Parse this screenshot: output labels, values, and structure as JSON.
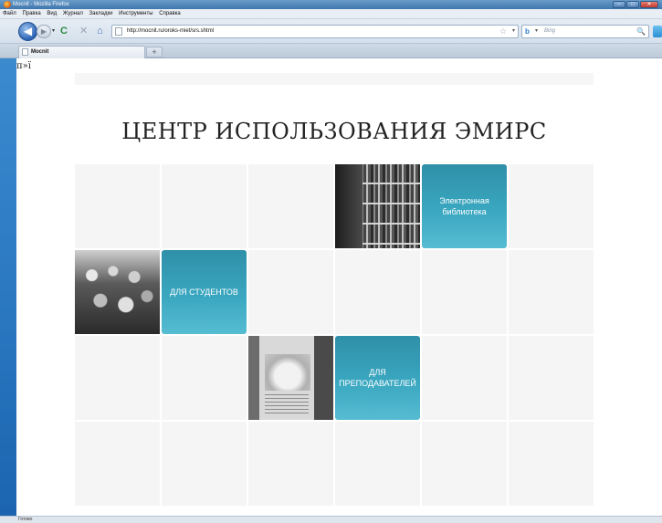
{
  "window": {
    "title": "Мосnit - Mozilla Firefox",
    "controls": [
      "‒",
      "□",
      "✕"
    ]
  },
  "menu": {
    "items": [
      "Файл",
      "Правка",
      "Вид",
      "Журнал",
      "Закладки",
      "Инструменты",
      "Справка"
    ]
  },
  "toolbar": {
    "back_glyph": "◀",
    "forward_glyph": "▶",
    "dropdown_glyph": "▾",
    "reload_glyph": "C",
    "stop_glyph": "✕",
    "home_glyph": "⌂",
    "url": "http://mocnit.ru/oroks-miet/srs.shtml",
    "bookmark_star": "☆",
    "url_dropdown": "▾",
    "search_placeholder": "Bing",
    "search_engine_glyph": "b",
    "search_dropdown": "▾",
    "search_glyph": "🔍"
  },
  "tabs": {
    "items": [
      {
        "label": "Mocnit"
      }
    ],
    "new_tab_glyph": "+"
  },
  "page": {
    "stray_text": "п»ї",
    "heading": "ЦЕНТР ИСПОЛЬЗОВАНИЯ ЭМИРС",
    "tiles": {
      "library": "Электронная библиотека",
      "students": "ДЛЯ СТУДЕНТОВ",
      "teachers": "ДЛЯ ПРЕПОДАВАТЕЛЕЙ"
    }
  },
  "status": {
    "text": "Готово"
  },
  "colors": {
    "tile_accent": "#3aa7c0",
    "cell_bg": "#f5f5f5"
  }
}
